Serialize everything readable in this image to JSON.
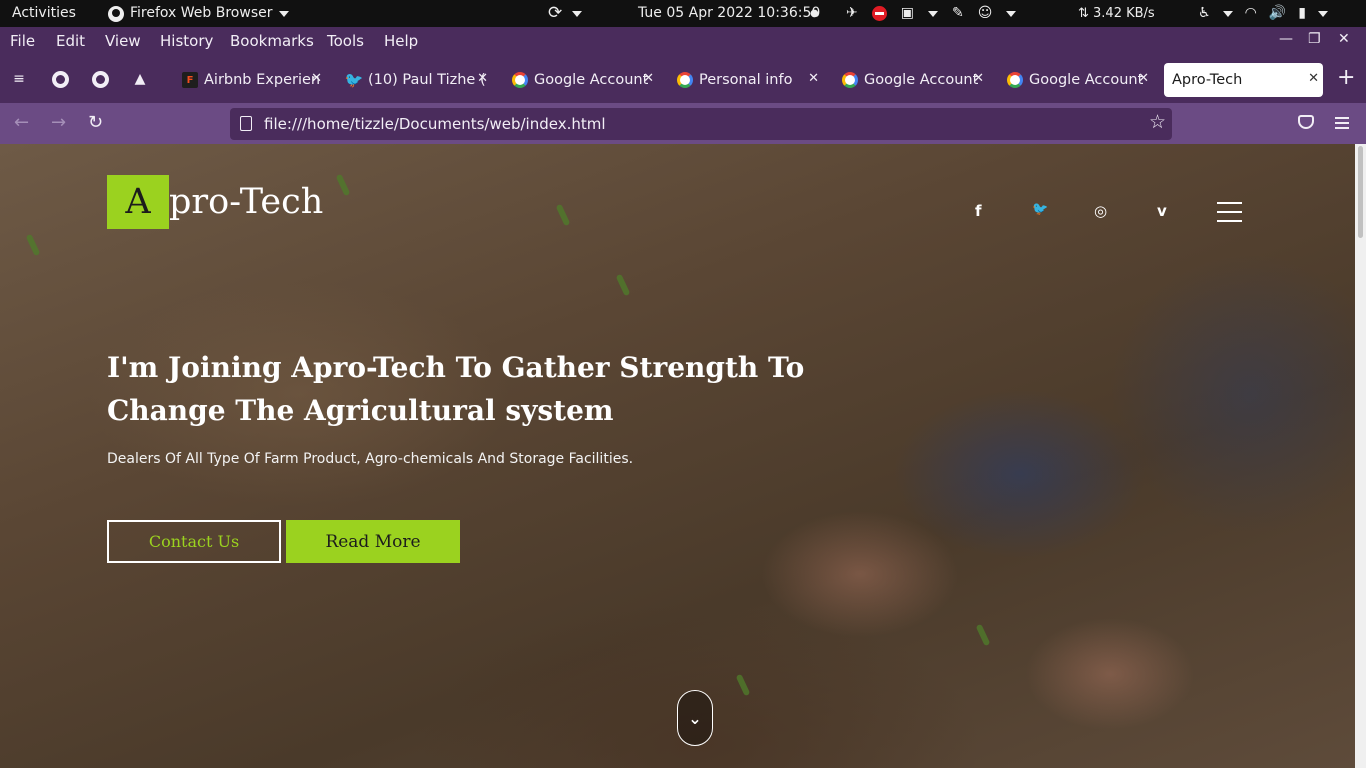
{
  "system_bar": {
    "activities": "Activities",
    "app_name": "Firefox Web Browser",
    "clock": "Tue 05 Apr 2022 10:36:50",
    "net_speed": "⇅ 3.42 KB/s"
  },
  "menu": {
    "file": "File",
    "edit": "Edit",
    "view": "View",
    "history": "History",
    "bookmarks": "Bookmarks",
    "tools": "Tools",
    "help": "Help"
  },
  "tabs": [
    {
      "title": "Airbnb Experien",
      "icon": "figma-icon"
    },
    {
      "title": "(10) Paul Tizhe (",
      "icon": "twitter-icon"
    },
    {
      "title": "Google Account",
      "icon": "google-icon"
    },
    {
      "title": "Personal info",
      "icon": "google-icon"
    },
    {
      "title": "Google Account",
      "icon": "google-icon"
    },
    {
      "title": "Google Account",
      "icon": "google-icon"
    },
    {
      "title": "Apro-Tech",
      "icon": "none",
      "active": true
    }
  ],
  "address_bar": {
    "url": "file:///home/tizzle/Documents/web/index.html"
  },
  "page": {
    "logo_letter": "A",
    "logo_rest": "pro-Tech",
    "social": {
      "facebook": "f",
      "twitter": "🐦",
      "dribbble": "◎",
      "vimeo": "v"
    },
    "hero_title": "I'm Joining Apro-Tech To Gather Strength To Change The Agricultural system",
    "hero_subtitle": "Dealers Of All Type Of Farm Product, Agro-chemicals And Storage Facilities.",
    "contact_button": "Contact Us",
    "read_more_button": "Read More",
    "accent_color": "#9bd21f"
  }
}
